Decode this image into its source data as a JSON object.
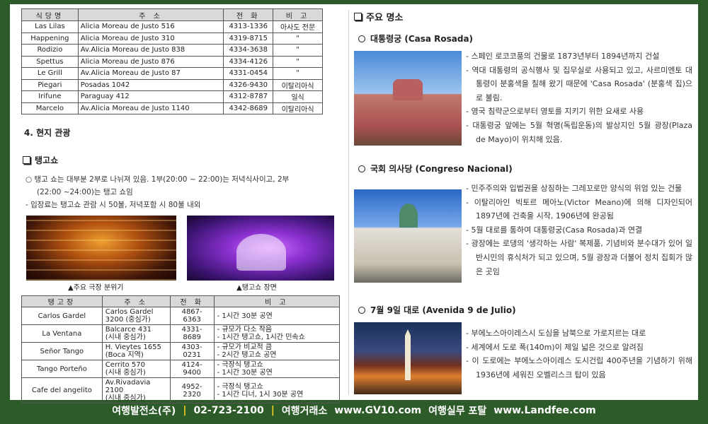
{
  "restaurants": {
    "headers": [
      "식당명",
      "주 소",
      "전 화",
      "비 고"
    ],
    "rows": [
      [
        "Las Lilas",
        "Alicia Moreau de Justo 516",
        "4313-1336",
        "아사도 전문"
      ],
      [
        "Happening",
        "Alicia Moreau de Justo 310",
        "4319-8715",
        "\""
      ],
      [
        "Rodizio",
        "Av.Alicia Moreau de Justo 838",
        "4334-3638",
        "\""
      ],
      [
        "Spettus",
        "Alicia Moreau de Justo 876",
        "4334-4126",
        "\""
      ],
      [
        "Le Grill",
        "Av.Alicia Moreau de Justo 87",
        "4331-0454",
        "\""
      ],
      [
        "Piegari",
        "Posadas 1042",
        "4326-9430",
        "이탈리아식"
      ],
      [
        "Irifune",
        "Paraguay 412",
        "4312-8787",
        "일식"
      ],
      [
        "Marcelo",
        "Av.Alicia Moreau de Justo 1140",
        "4342-8689",
        "이탈리아식"
      ]
    ]
  },
  "section4": {
    "title": "4. 현지 관광"
  },
  "tango": {
    "heading": "탱고쇼",
    "intro_line1": "○ 탱고 쇼는 대부분 2부로 나뉘져 있음. 1부(20:00 ~ 22:00)는 저녁식사이고, 2부",
    "intro_line2": "(22:00 ~24:00)는 탱고 쇼임",
    "intro_line3": "- 입장료는 탱고쇼 관람 시 50불, 저녁포함 시 80불 내외",
    "caption1": "▲주요 극장 분위기",
    "caption2": "▲탱고쇼 장면",
    "table": {
      "headers": [
        "탱고장",
        "주 소",
        "전 화",
        "비 고"
      ],
      "rows": [
        {
          "name": "Carlos Gardel",
          "addr1": "Carlos Gardel",
          "addr2": "3200 (중심가)",
          "phone": "4867-6363",
          "note1": "- 1시간 30분 공연",
          "note2": ""
        },
        {
          "name": "La Ventana",
          "addr1": "Balcarce 431",
          "addr2": "(시내 중심가)",
          "phone": "4331-8689",
          "note1": "- 규모가 다소 작음",
          "note2": "- 1시간 탱고쇼, 1시간 민속쇼"
        },
        {
          "name": "Señor Tango",
          "addr1": "H. Vieytes 1655",
          "addr2": "(Boca 지역)",
          "phone": "4303-0231",
          "note1": "- 규모가 비교적 큼",
          "note2": "- 2시간 탱고쇼 공연"
        },
        {
          "name": "Tango Porteño",
          "addr1": "Cerrito 570",
          "addr2": "(시내 중심가)",
          "phone": "4124-9400",
          "note1": "- 극장식 탱고쇼",
          "note2": "- 1시간 30분 공연"
        },
        {
          "name": "Cafe del angelito",
          "addr1": "Av.Rivadavia",
          "addr2": "2100",
          "addr3": "(시내 중심가)",
          "phone": "4952-2320",
          "note1": "- 극장식 탱고쇼",
          "note2": "- 1시간 디너, 1시 30분 공연"
        }
      ]
    }
  },
  "sights": {
    "heading": "주요 명소",
    "items": [
      {
        "title": "대통령궁 (Casa Rosada)",
        "bullets": [
          "- 스페인 로코코풍의 건물로 1873년부터 1894년까지 건설",
          "- 역대 대통령의 공식행사 및 집무실로 사용되고 있고, 사르미엔토 대통령이 분홍색을 칠해 왔기 때문에 'Casa Rosada' (분홍색 집)으로 불림.",
          "- 영국 침략군으로부터 영토를 지키기 위한 요새로 사용",
          "- 대통령궁 앞에는 5월 혁명(독립운동)의 발상지인 5월 광장(Plaza de Mayo)이 위치해 있음."
        ]
      },
      {
        "title": "국회 의사당 (Congreso Nacional)",
        "bullets": [
          "- 민주주의와 입법권을 상징하는 그레꼬로만 양식의 위엄 있는 건물",
          "- 이탈리아인 빅토르 메아노(Victor Meano)에 의해 디자인되어 1897년에 건축을 시작, 1906년에 완공됨",
          "- 5월 대로를 통하여 대통령궁(Casa Rosada)과 연결",
          "- 광장에는 로댕의 '생각하는 사람' 복제품, 기념비와 분수대가 있어 일반시민의 휴식처가 되고 있으며, 5월 광장과 더불어 정치 집회가 많은 곳임"
        ]
      },
      {
        "title": "7월 9일 대로 (Avenida 9 de Julio)",
        "bullets": [
          "- 부에노스아이레스시 도심을 남북으로 가로지르는 대로",
          "- 세계에서 도로 폭(140m)이 제일 넓은 것으로 알려짐",
          "- 이 도로에는 부에노스아이레스 도시건립 400주년을 기념하기 위해 1936년에 세워진 오벨리스크 탑이 있음"
        ]
      }
    ]
  },
  "footer": {
    "company": "여행발전소(주)",
    "phone": "02-723-2100",
    "market": "여행거래소",
    "site1": "www.GV10.com",
    "portal": "여행실무 포탈",
    "site2": "www.Landfee.com"
  }
}
